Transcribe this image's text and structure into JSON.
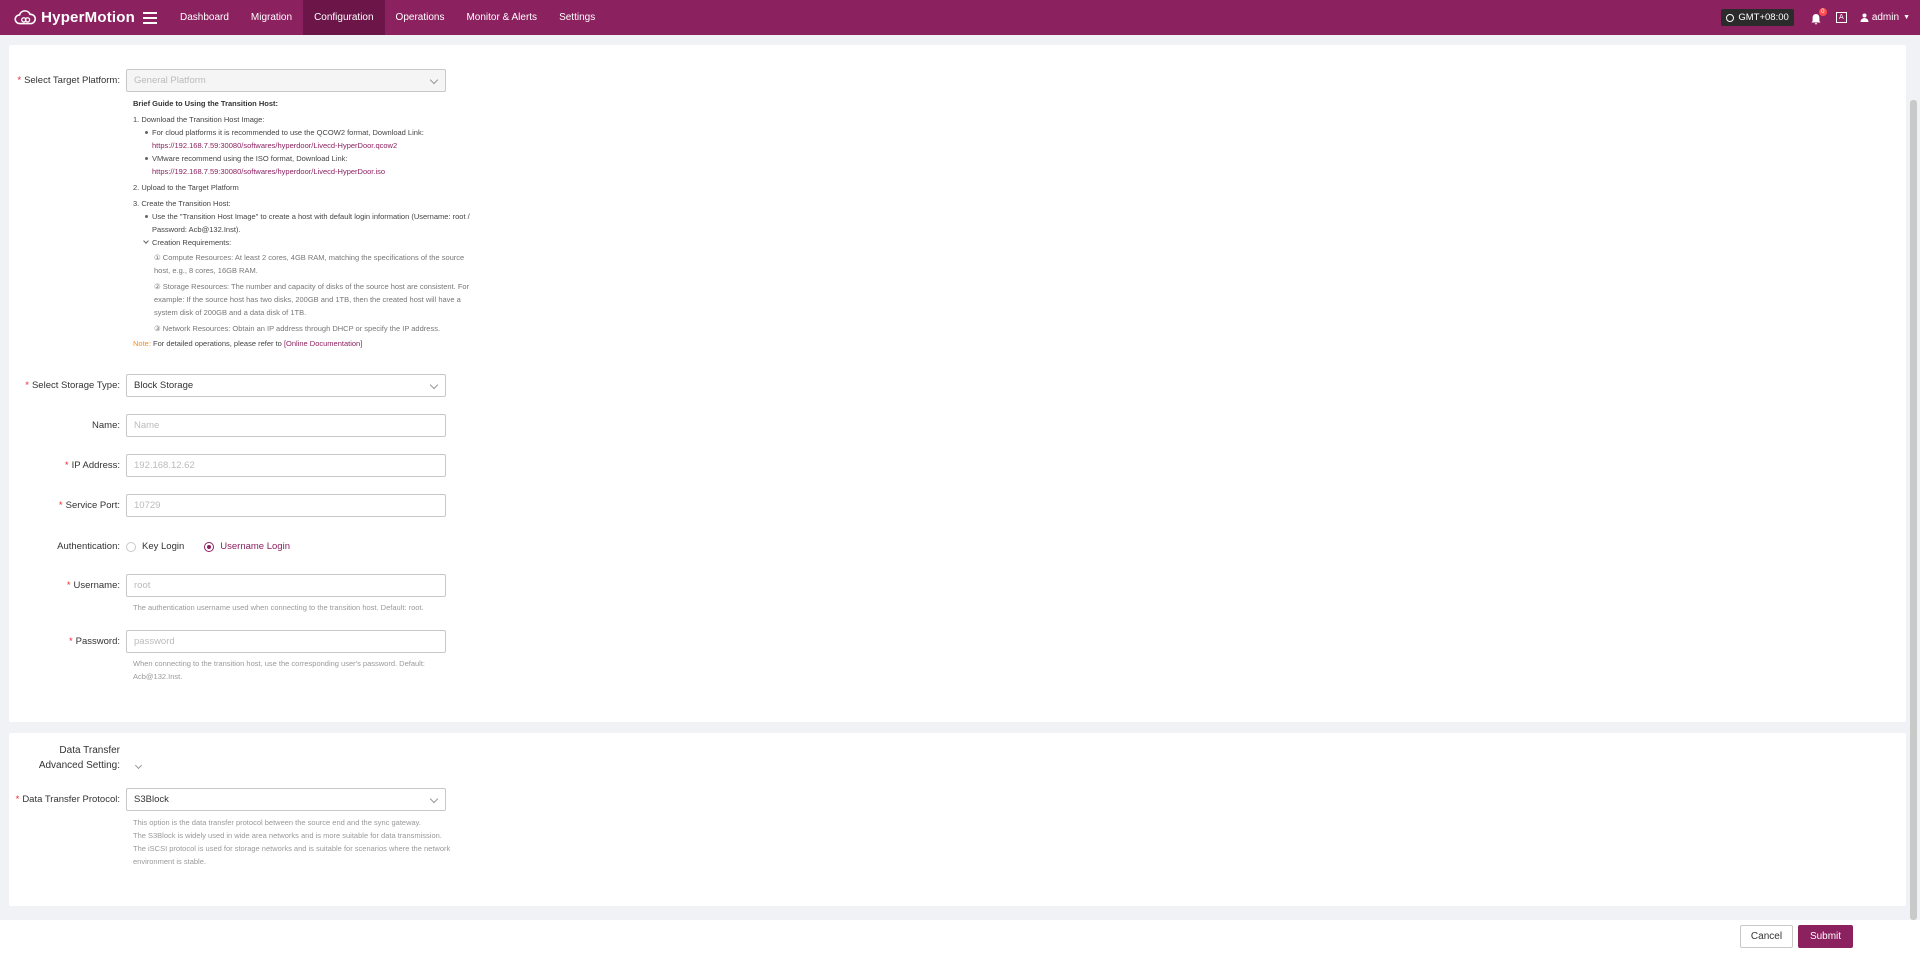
{
  "app": {
    "name": "HyperMotion"
  },
  "nav": {
    "items": [
      {
        "label": "Dashboard"
      },
      {
        "label": "Migration"
      },
      {
        "label": "Configuration"
      },
      {
        "label": "Operations"
      },
      {
        "label": "Monitor & Alerts"
      },
      {
        "label": "Settings"
      }
    ]
  },
  "topbar": {
    "timezone": "GMT+08:00",
    "notification_count": "0",
    "user": "admin"
  },
  "form": {
    "target_platform": {
      "label": "Select Target Platform:",
      "value": "General Platform"
    },
    "guide": {
      "title": "Brief Guide to Using the Transition Host:",
      "step1": "1. Download the Transition Host Image:",
      "step1_a": "For cloud platforms it is recommended to use the QCOW2 format, Download Link:",
      "step1_a_link": "https://192.168.7.59:30080/softwares/hyperdoor/Livecd-HyperDoor.qcow2",
      "step1_b": "VMware recommend using the ISO format, Download Link:",
      "step1_b_link": "https://192.168.7.59:30080/softwares/hyperdoor/Livecd-HyperDoor.iso",
      "step2": "2. Upload to the Target Platform",
      "step3": "3. Create the Transition Host:",
      "step3_a": "Use the \"Transition Host Image\" to create a host with default login information (Username: root / Password: Acb@132.Inst).",
      "step3_b": "Creation Requirements:",
      "req1": "① Compute Resources: At least 2 cores, 4GB RAM, matching the specifications of the source host, e.g., 8 cores, 16GB RAM.",
      "req2": "② Storage Resources: The number and capacity of disks of the source host are consistent. For example: If the source host has two disks, 200GB and 1TB, then the created host will have a system disk of 200GB and a data disk of 1TB.",
      "req3": "③ Network Resources: Obtain an IP address through DHCP or specify the IP address.",
      "note_prefix": "Note:",
      "note_text": " For detailed operations, please refer to ",
      "note_link": "[Online Documentation]"
    },
    "storage_type": {
      "label": "Select Storage Type:",
      "value": "Block Storage"
    },
    "name": {
      "label": "Name:",
      "placeholder": "Name"
    },
    "ip": {
      "label": "IP Address:",
      "placeholder": "192.168.12.62"
    },
    "port": {
      "label": "Service Port:",
      "placeholder": "10729"
    },
    "auth": {
      "label": "Authentication:",
      "option_key": "Key Login",
      "option_user": "Username Login",
      "selected": "Username Login"
    },
    "username": {
      "label": "Username:",
      "placeholder": "root",
      "help": "The authentication username used when connecting to the transition host. Default: root."
    },
    "password": {
      "label": "Password:",
      "placeholder": "password",
      "help": "When connecting to the transition host, use the corresponding user's password. Default: Acb@132.Inst."
    },
    "advanced": {
      "label_line1": "Data Transfer",
      "label_line2": "Advanced Setting:"
    },
    "protocol": {
      "label": "Data Transfer Protocol:",
      "value": "S3Block",
      "help1": "This option is the data transfer protocol between the source end and the sync gateway.",
      "help2": "The S3Block is widely used in wide area networks and is more suitable for data transmission.",
      "help3": "The iSCSI protocol is used for storage networks and is suitable for scenarios where the network environment is stable."
    }
  },
  "footer": {
    "cancel": "Cancel",
    "submit": "Submit"
  },
  "colors": {
    "brand": "#8c2160",
    "required": "#f5222d",
    "note": "#fa8c16"
  }
}
